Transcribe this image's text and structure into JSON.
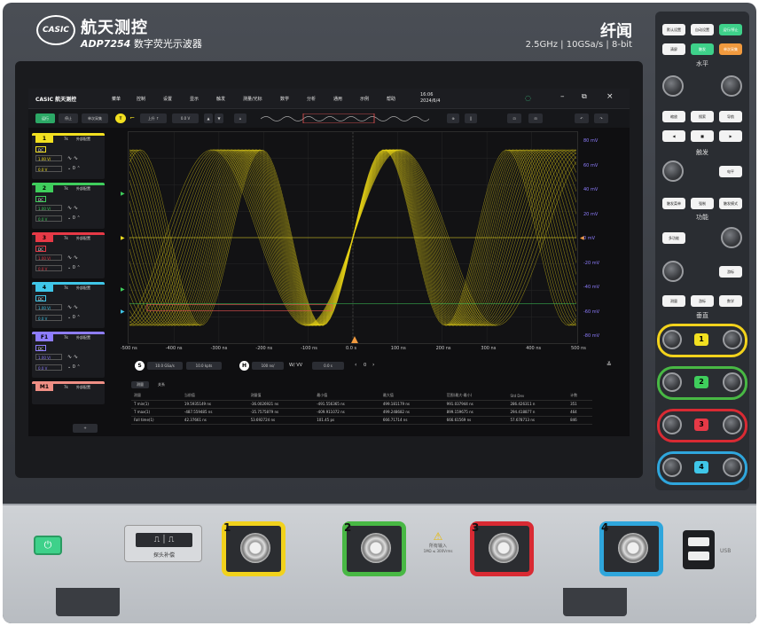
{
  "brand": {
    "logo_text": "CASIC",
    "name_cn": "航天测控",
    "model_bold": "ADP",
    "model_num": "7254",
    "model_desc": "数字荧光示波器",
    "series": "纤闻",
    "specs": "2.5GHz | 10GSa/s | 8-bit"
  },
  "menubar": {
    "logo": "CASIC 航天测控",
    "items": [
      "菜单",
      "控制",
      "设置",
      "显示",
      "触发",
      "测量/光标",
      "数学",
      "分析",
      "通用",
      "示例",
      "帮助"
    ],
    "time": "16:06",
    "date": "2024/6/4"
  },
  "toolbar": {
    "run": "运行",
    "stop": "停止",
    "single": "单次采集",
    "trigger_label": "T",
    "edge": "上升 ↑",
    "level": "0.0 V"
  },
  "channels": [
    {
      "num": "1",
      "color": "#f2e020",
      "coupling": "DC",
      "scale": "1.00 V/",
      "offset": "0.0 V",
      "mode": "7k",
      "label": "外部配置"
    },
    {
      "num": "2",
      "color": "#3fce5c",
      "coupling": "DC",
      "scale": "1.00 V/",
      "offset": "0.0 V",
      "mode": "7k",
      "label": "外部配置"
    },
    {
      "num": "3",
      "color": "#e63946",
      "coupling": "DC",
      "scale": "1.00 V/",
      "offset": "0.0 V",
      "mode": "7k",
      "label": "外部配置"
    },
    {
      "num": "4",
      "color": "#3fc6e8",
      "coupling": "DC",
      "scale": "1.00 V/",
      "offset": "0.0 V",
      "mode": "7k",
      "label": "外部配置"
    },
    {
      "num": "F1",
      "color": "#8e7dff",
      "coupling": "DC",
      "scale": "1.00 V/",
      "offset": "0.0 V",
      "mode": "7k",
      "label": "外部配置"
    },
    {
      "num": "M1",
      "color": "#ef8f85",
      "coupling": "",
      "scale": "",
      "offset": "",
      "mode": "7k",
      "label": "外部配置"
    }
  ],
  "axes": {
    "x_ticks": [
      "-500 ns",
      "-400 ns",
      "-300 ns",
      "-200 ns",
      "-100 ns",
      "0.0 s",
      "100 ns",
      "200 ns",
      "300 ns",
      "400 ns",
      "500 ns"
    ],
    "y_ticks": [
      "80 mV",
      "60 mV",
      "40 mV",
      "20 mV",
      "0 mV",
      "-20 mV",
      "-40 mV",
      "-60 mV",
      "-80 mV"
    ]
  },
  "bottom": {
    "sample_label": "S",
    "sample_rate": "10.0 GSa/s",
    "points": "10.0 kpts",
    "horizontal_label": "H",
    "timebase": "100 ns/",
    "delay": "0.0 s",
    "page_num": "0"
  },
  "measure": {
    "tabs": [
      "测量",
      "关系"
    ],
    "headers": [
      "测量",
      "当前值",
      "测量值",
      "最小值",
      "最大值",
      "范围(最大-最小)",
      "Std Dev",
      "计数"
    ],
    "rows": [
      [
        "T min(1)",
        "19.5935149 ns",
        "-36.0026921 ns",
        "-491.556365 ns",
        "499.181179 ns",
        "991.037944 ns",
        "286.426311 n",
        "351"
      ],
      [
        "T max(1)",
        "-487.559485 ns",
        "-35.7575879 ns",
        "-409.911072 ns",
        "499.248682 ns",
        "899.159675 ns",
        "294.418877 n",
        "464"
      ],
      [
        "Fall time(1)",
        "42.37661 ns",
        "53.692724 ns",
        "101.45 ps",
        "666.71714 ns",
        "666.61569 ns",
        "57.678713 ns",
        "846"
      ]
    ]
  },
  "panel": {
    "top_buttons": [
      "默认设置",
      "自动设置",
      "运行/停止",
      "清屏",
      "触发",
      "单次采集"
    ],
    "sections": [
      "水平",
      "触发",
      "功能",
      "垂直"
    ],
    "h_buttons": [
      "缩放",
      "搜索",
      "导航"
    ],
    "t_buttons": [
      "触发菜单",
      "强制",
      "触发模式"
    ],
    "f_buttons": [
      "测量",
      "游标",
      "数学"
    ]
  },
  "front": {
    "ports": [
      "1",
      "2",
      "3",
      "4"
    ],
    "port_colors": [
      "#f2d21c",
      "#48b844",
      "#d92a33",
      "#2fa6dc"
    ],
    "warning": "所有输入",
    "warning_sub": "1MΩ ≤ 300Vrms",
    "probe_label": "探头补偿",
    "usb_label": "USB"
  }
}
